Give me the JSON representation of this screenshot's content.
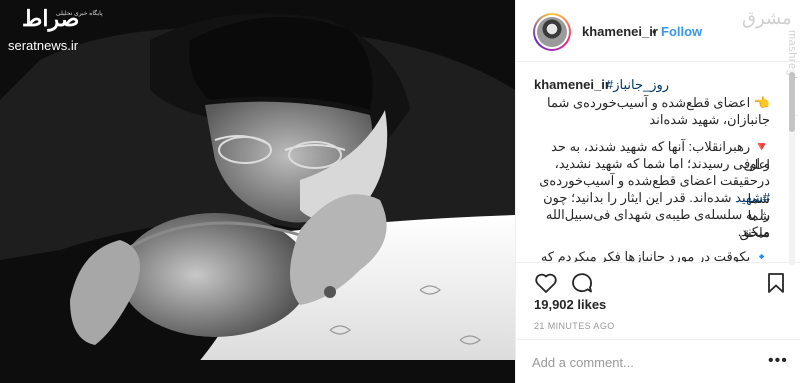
{
  "photo": {
    "watermark_name": "صراط",
    "watermark_subtitle": "پایگاه خبری تحلیلی",
    "watermark_site": "seratnews.ir"
  },
  "header": {
    "username": "khamenei_ir",
    "separator": "•",
    "follow_label": "Follow",
    "watermark": "ﻣﺸﺮﻕ",
    "watermark_vertical": "mashreghnews.ir"
  },
  "caption": {
    "username": "khamenei_ir",
    "hashtag": "#روز_جانباز",
    "line1": "اعضای قطع‌شده و آسیب‌خورده‌ی شما",
    "line2": "جانبازان، شهید شده‌اند",
    "para_line1": "رهبرانقلاب: آنها که شهید شدند، به حد اعلی",
    "para_line2": "و اوفی رسیدند؛ اما شما که شهید نشدید،",
    "para_line3": "درحقیقت اعضای قطع‌شده و آسیب‌خورده‌ی شما",
    "para_line4_tag": "#شهید",
    "para_line4_rest": " شده‌اند. قدر این ایثار را بدانید؛ چون شما",
    "para_line5": "را به سلسله‌ی طیبه‌ی شهدای فی‌سبیل‌الله ملحق",
    "para_line6": "میکند.",
    "para_line7": "یکوقت در مورد جانبازها فکر میکردم که به"
  },
  "icons": {
    "hand": "👈",
    "triangle": "🔻",
    "diamond": "🔹"
  },
  "stats": {
    "likes": "19,902 likes",
    "time": "21 MINUTES AGO"
  },
  "comment": {
    "placeholder": "Add a comment...",
    "more": "•••"
  }
}
